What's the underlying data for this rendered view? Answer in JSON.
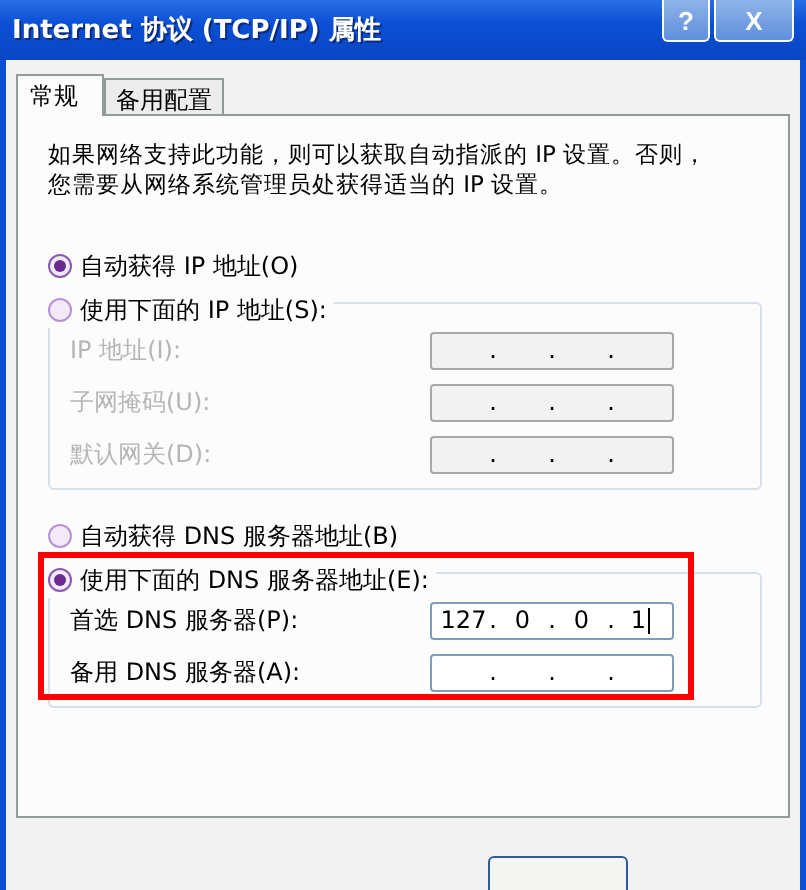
{
  "window": {
    "title": "Internet 协议 (TCP/IP) 属性",
    "help_button": "?",
    "close_button": "X"
  },
  "tabs": [
    {
      "label": "常规",
      "selected": true
    },
    {
      "label": "备用配置",
      "selected": false
    }
  ],
  "description": "如果网络支持此功能，则可以获取自动指派的 IP 设置。否则，您需要从网络系统管理员处获得适当的 IP 设置。",
  "octet_separator": ".",
  "ip_section": {
    "options": [
      {
        "label": "自动获得 IP 地址(O)",
        "selected": true
      },
      {
        "label": "使用下面的 IP 地址(S):",
        "selected": false
      }
    ],
    "fields": [
      {
        "label": "IP 地址(I):",
        "disabled": true
      },
      {
        "label": "子网掩码(U):",
        "disabled": true
      },
      {
        "label": "默认网关(D):",
        "disabled": true
      }
    ]
  },
  "dns_section": {
    "options": [
      {
        "label": "自动获得 DNS 服务器地址(B)",
        "selected": false
      },
      {
        "label": "使用下面的 DNS 服务器地址(E):",
        "selected": true
      }
    ],
    "fields": [
      {
        "label": "首选 DNS 服务器(P):",
        "disabled": false,
        "value": [
          "127",
          "0",
          "0",
          "1"
        ],
        "caret": true
      },
      {
        "label": "备用 DNS 服务器(A):",
        "disabled": false
      }
    ],
    "highlighted": true
  }
}
